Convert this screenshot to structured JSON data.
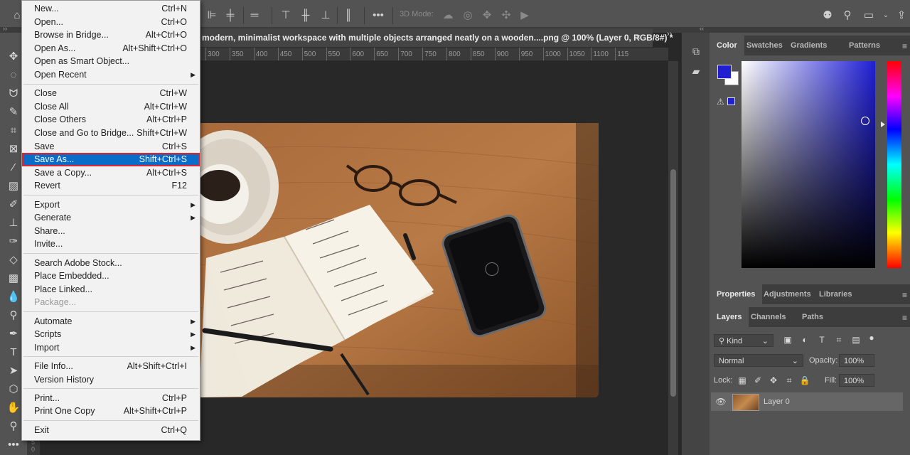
{
  "option_bar": {
    "icons": [
      "home-icon",
      "align-left-icon",
      "align-center-icon",
      "align-right-icon",
      "align-top-icon",
      "align-middle-icon",
      "align-bottom-icon",
      "more-options-icon",
      "orbit-3d-icon",
      "roll-3d-icon",
      "pan-3d-icon",
      "slide-3d-icon",
      "scale-3d-icon",
      "search-icon",
      "workspace-icon",
      "share-icon"
    ],
    "mode_3d_label": "3D Mode:"
  },
  "document": {
    "tab_title": "modern, minimalist workspace with multiple objects arranged neatly on a wooden....png @ 100% (Layer 0, RGB/8#) *",
    "close_label": "×"
  },
  "ruler": {
    "horizontal_ticks": [
      "300",
      "350",
      "400",
      "450",
      "500",
      "550",
      "600",
      "650",
      "700",
      "750",
      "800",
      "850",
      "900",
      "950",
      "1000",
      "1050",
      "1100",
      "115"
    ],
    "vertical_ticks": [
      "5",
      "0"
    ]
  },
  "file_menu": {
    "groups": [
      [
        {
          "label": "New...",
          "shortcut": "Ctrl+N"
        },
        {
          "label": "Open...",
          "shortcut": "Ctrl+O"
        },
        {
          "label": "Browse in Bridge...",
          "shortcut": "Alt+Ctrl+O"
        },
        {
          "label": "Open As...",
          "shortcut": "Alt+Shift+Ctrl+O"
        },
        {
          "label": "Open as Smart Object...",
          "shortcut": ""
        },
        {
          "label": "Open Recent",
          "shortcut": "",
          "submenu": true
        }
      ],
      [
        {
          "label": "Close",
          "shortcut": "Ctrl+W"
        },
        {
          "label": "Close All",
          "shortcut": "Alt+Ctrl+W"
        },
        {
          "label": "Close Others",
          "shortcut": "Alt+Ctrl+P"
        },
        {
          "label": "Close and Go to Bridge...",
          "shortcut": "Shift+Ctrl+W"
        },
        {
          "label": "Save",
          "shortcut": "Ctrl+S"
        },
        {
          "label": "Save As...",
          "shortcut": "Shift+Ctrl+S",
          "highlighted": true
        },
        {
          "label": "Save a Copy...",
          "shortcut": "Alt+Ctrl+S"
        },
        {
          "label": "Revert",
          "shortcut": "F12"
        }
      ],
      [
        {
          "label": "Export",
          "shortcut": "",
          "submenu": true
        },
        {
          "label": "Generate",
          "shortcut": "",
          "submenu": true
        },
        {
          "label": "Share...",
          "shortcut": ""
        },
        {
          "label": "Invite...",
          "shortcut": ""
        }
      ],
      [
        {
          "label": "Search Adobe Stock...",
          "shortcut": ""
        },
        {
          "label": "Place Embedded...",
          "shortcut": ""
        },
        {
          "label": "Place Linked...",
          "shortcut": ""
        },
        {
          "label": "Package...",
          "shortcut": "",
          "disabled": true
        }
      ],
      [
        {
          "label": "Automate",
          "shortcut": "",
          "submenu": true
        },
        {
          "label": "Scripts",
          "shortcut": "",
          "submenu": true
        },
        {
          "label": "Import",
          "shortcut": "",
          "submenu": true
        }
      ],
      [
        {
          "label": "File Info...",
          "shortcut": "Alt+Shift+Ctrl+I"
        },
        {
          "label": "Version History",
          "shortcut": ""
        }
      ],
      [
        {
          "label": "Print...",
          "shortcut": "Ctrl+P"
        },
        {
          "label": "Print One Copy",
          "shortcut": "Alt+Shift+Ctrl+P"
        }
      ],
      [
        {
          "label": "Exit",
          "shortcut": "Ctrl+Q"
        }
      ]
    ]
  },
  "tools": [
    "move-tool-icon",
    "marquee-tool-icon",
    "lasso-tool-icon",
    "quick-select-tool-icon",
    "crop-tool-icon",
    "frame-tool-icon",
    "eyedropper-tool-icon",
    "healing-brush-icon",
    "brush-tool-icon",
    "clone-stamp-icon",
    "history-brush-icon",
    "eraser-tool-icon",
    "gradient-tool-icon",
    "blur-tool-icon",
    "dodge-tool-icon",
    "pen-tool-icon",
    "type-tool-icon",
    "path-select-icon",
    "shape-tool-icon",
    "hand-tool-icon",
    "zoom-tool-icon",
    "more-tools-icon"
  ],
  "panels": {
    "color_tabs": [
      "Color",
      "Swatches",
      "Gradients",
      "Patterns"
    ],
    "colors": {
      "foreground": "#1f1fd1",
      "background": "#ffffff"
    },
    "gamut_warning_symbol": "⚠",
    "properties_tabs": [
      "Properties",
      "Adjustments",
      "Libraries"
    ],
    "layers_tabs": [
      "Layers",
      "Channels",
      "Paths"
    ],
    "layers": {
      "filter_kind": "Kind",
      "blend_mode": "Normal",
      "opacity_label": "Opacity:",
      "opacity_value": "100%",
      "lock_label": "Lock:",
      "fill_label": "Fill:",
      "fill_value": "100%",
      "layer_name": "Layer 0"
    }
  }
}
